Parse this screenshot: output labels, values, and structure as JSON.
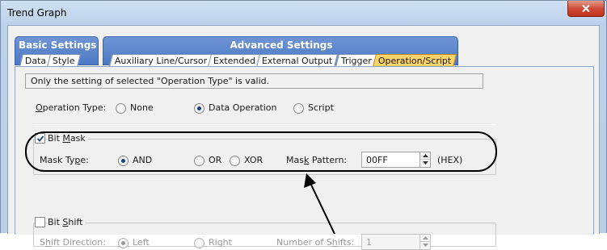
{
  "window": {
    "title": "Trend Graph",
    "close_icon": "close-icon"
  },
  "tab_groups": {
    "basic": {
      "label": "Basic Settings",
      "tabs": [
        "Data",
        "Style"
      ]
    },
    "advanced": {
      "label": "Advanced Settings",
      "tabs": [
        "Auxiliary Line/Cursor",
        "Extended",
        "External Output",
        "Trigger",
        "Operation/Script"
      ],
      "active_tab": "Operation/Script"
    }
  },
  "note": "Only the setting of selected  \"Operation Type\" is valid.",
  "operation_type": {
    "label": "Operation Type:",
    "label_mnemonic": "O",
    "label_rest": "peration Type:",
    "options": [
      "None",
      "Data Operation",
      "Script"
    ],
    "selected": "Data Operation"
  },
  "bit_mask": {
    "checkbox_label_pre": "Bit ",
    "checkbox_label_mnemonic": "M",
    "checkbox_label_post": "ask",
    "checked": true,
    "mask_type_label_pre": "Mask Ty",
    "mask_type_label_mnemonic": "p",
    "mask_type_label_post": "e:",
    "mask_type_options": [
      "AND",
      "OR",
      "XOR"
    ],
    "mask_type_selected": "AND",
    "pattern_label_pre": "Mas",
    "pattern_label_mnemonic": "k",
    "pattern_label_post": " Pattern:",
    "pattern_value": "00FF",
    "pattern_unit": "(HEX)"
  },
  "bit_shift": {
    "checkbox_label_pre": "Bit ",
    "checkbox_label_mnemonic": "S",
    "checkbox_label_post": "hift",
    "checked": false,
    "direction_label_pre": "S",
    "direction_label_mnemonic": "h",
    "direction_label_post": "ift Direction:",
    "direction_options": [
      "Left",
      "Right"
    ],
    "direction_selected": "Left",
    "shifts_label_pre": "Number of S",
    "shifts_label_mnemonic": "h",
    "shifts_label_post": "ifts:",
    "shifts_value": "1"
  },
  "colors": {
    "tab_group": "#4d78c3",
    "active_tab": "#ffd36b",
    "title_bar": "#cfe0f3",
    "close_button": "#cf4d3a"
  }
}
